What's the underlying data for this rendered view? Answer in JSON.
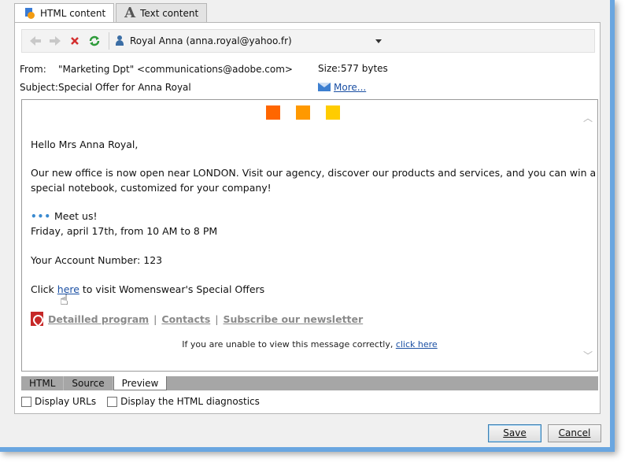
{
  "tabs": {
    "html_content": "HTML content",
    "text_content": "Text content"
  },
  "toolbar": {
    "recipient": "Royal Anna (anna.royal@yahoo.fr)"
  },
  "header": {
    "from_label": "From:",
    "from_value": "\"Marketing Dpt\" <communications@adobe.com>",
    "subject_label": "Subject:",
    "subject_value": "Special Offer for Anna Royal",
    "size_label": "Size:",
    "size_value": "577 bytes",
    "more_link": "More..."
  },
  "preview": {
    "square_colors": [
      "#ff6600",
      "#ff9900",
      "#ffcc00"
    ],
    "greeting": "Hello Mrs Anna Royal,",
    "para_line1": "Our new office is now open near LONDON. Visit our agency, discover our products and services, and you can win a",
    "para_line2": "special notebook, customized for your company!",
    "meet_dots": "•••",
    "meet": "Meet us!",
    "date": "Friday, april 17th, from 10 AM to 8 PM",
    "account": "Your Account Number: 123",
    "click_prefix": "Click ",
    "here_link": "here",
    "click_suffix": " to visit Womenswear's Special Offers",
    "links": [
      "Detailled program",
      "Contacts",
      "Subscribe our newsletter"
    ],
    "link_separator": "|",
    "unable_text": "If you are unable to view this message correctly, ",
    "unable_link": "click here"
  },
  "bottom_tabs": [
    "HTML",
    "Source",
    "Preview"
  ],
  "checkboxes": {
    "display_urls": "Display URLs",
    "display_diag": "Display the HTML diagnostics"
  },
  "buttons": {
    "save": "Save",
    "cancel": "Cancel"
  }
}
